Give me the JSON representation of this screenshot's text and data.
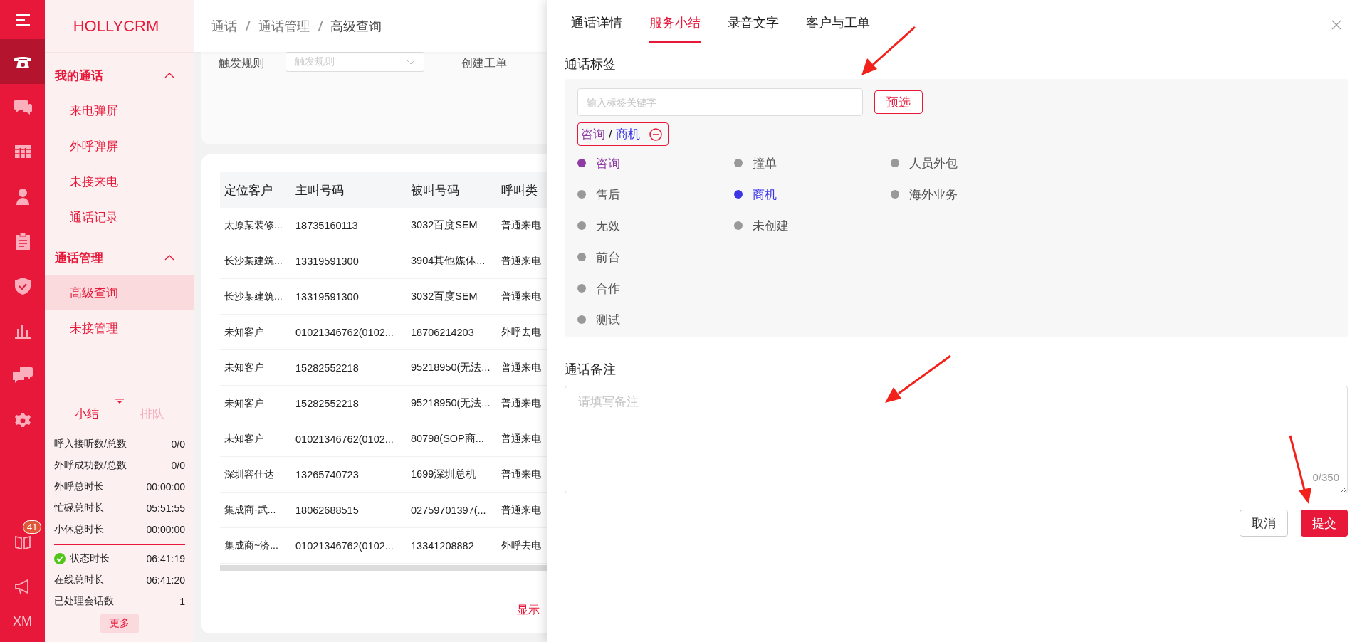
{
  "rail": {
    "items": [
      {
        "selected": true
      },
      {
        "selected": false
      },
      {
        "selected": false
      },
      {
        "selected": false
      },
      {
        "selected": false
      },
      {
        "selected": false
      },
      {
        "selected": false
      },
      {
        "selected": false
      },
      {
        "selected": false
      }
    ],
    "badge": "41",
    "user": "XM"
  },
  "brand": "HOLLYCRM",
  "nav": [
    {
      "label": "我的通话",
      "expanded": true,
      "children": [
        {
          "label": "来电弹屏",
          "selected": false
        },
        {
          "label": "外呼弹屏",
          "selected": false
        },
        {
          "label": "未接来电",
          "selected": false
        },
        {
          "label": "通话记录",
          "selected": false
        }
      ]
    },
    {
      "label": "通话管理",
      "expanded": true,
      "children": [
        {
          "label": "高级查询",
          "selected": true
        },
        {
          "label": "未接管理",
          "selected": false
        }
      ]
    }
  ],
  "stats": {
    "tabs": [
      {
        "label": "小结",
        "selected": true
      },
      {
        "label": "排队",
        "selected": false
      }
    ],
    "rows": [
      {
        "label": "呼入接听数/总数",
        "value": "0/0",
        "status": false
      },
      {
        "label": "外呼成功数/总数",
        "value": "0/0",
        "status": false
      },
      {
        "label": "外呼总时长",
        "value": "00:00:00",
        "status": false
      },
      {
        "label": "忙碌总时长",
        "value": "05:51:55",
        "status": false
      },
      {
        "label": "小休总时长",
        "value": "00:00:00",
        "status": false
      }
    ],
    "rows2": [
      {
        "label": "状态时长",
        "value": "06:41:19",
        "status": true
      },
      {
        "label": "在线总时长",
        "value": "06:41:20",
        "status": false
      },
      {
        "label": "已处理会话数",
        "value": "1",
        "status": false
      }
    ],
    "more": "更多"
  },
  "breadcrumb": [
    "通话",
    "通话管理",
    "高级查询"
  ],
  "filters": {
    "rule_label": "触发规则",
    "rule_placeholder": "触发规则",
    "ticket_label": "创建工单"
  },
  "table": {
    "columns": [
      "定位客户",
      "主叫号码",
      "被叫号码",
      "呼叫类"
    ],
    "rows": [
      [
        "太原某装修...",
        "18735160113",
        "3032百度SEM",
        "普通来电"
      ],
      [
        "长沙某建筑...",
        "13319591300",
        "3904其他媒体...",
        "普通来电"
      ],
      [
        "长沙某建筑...",
        "13319591300",
        "3032百度SEM",
        "普通来电"
      ],
      [
        "未知客户",
        "01021346762(0102...",
        "18706214203",
        "外呼去电"
      ],
      [
        "未知客户",
        "15282552218",
        "95218950(无法...",
        "普通来电"
      ],
      [
        "未知客户",
        "15282552218",
        "95218950(无法...",
        "普通来电"
      ],
      [
        "未知客户",
        "01021346762(0102...",
        "80798(SOP商...",
        "普通来电"
      ],
      [
        "深圳容仕达",
        "13265740723",
        "1699深圳总机",
        "普通来电"
      ],
      [
        "集成商-武...",
        "18062688515",
        "02759701397(...",
        "普通来电"
      ],
      [
        "集成商~济...",
        "01021346762(0102...",
        "13341208882",
        "外呼去电"
      ]
    ],
    "footer": "显示"
  },
  "drawer": {
    "tabs": [
      {
        "label": "通话详情",
        "selected": false
      },
      {
        "label": "服务小结",
        "selected": true
      },
      {
        "label": "录音文字",
        "selected": false
      },
      {
        "label": "客户与工单",
        "selected": false
      }
    ],
    "tags_title": "通话标签",
    "search_placeholder": "输入标签关键字",
    "preselect": "预选",
    "chosen": [
      {
        "label": "咨询",
        "color": "#8e3ba4"
      },
      {
        "label": "商机",
        "color": "#3c35e8"
      }
    ],
    "separator": "/",
    "tag_columns": [
      [
        {
          "label": "咨询",
          "selected": true,
          "color": "#8e3ba4"
        },
        {
          "label": "售后",
          "selected": false,
          "color": "#999999"
        },
        {
          "label": "无效",
          "selected": false,
          "color": "#999999"
        },
        {
          "label": "前台",
          "selected": false,
          "color": "#999999"
        },
        {
          "label": "合作",
          "selected": false,
          "color": "#999999"
        },
        {
          "label": "测试",
          "selected": false,
          "color": "#999999"
        }
      ],
      [
        {
          "label": "撞单",
          "selected": false,
          "color": "#999999"
        },
        {
          "label": "商机",
          "selected": true,
          "color": "#3c35e8"
        },
        {
          "label": "未创建",
          "selected": false,
          "color": "#999999"
        }
      ],
      [
        {
          "label": "人员外包",
          "selected": false,
          "color": "#999999"
        },
        {
          "label": "海外业务",
          "selected": false,
          "color": "#999999"
        }
      ]
    ],
    "notes_title": "通话备注",
    "notes_placeholder": "请填写备注",
    "counter": "0/350",
    "cancel": "取消",
    "submit": "提交"
  }
}
